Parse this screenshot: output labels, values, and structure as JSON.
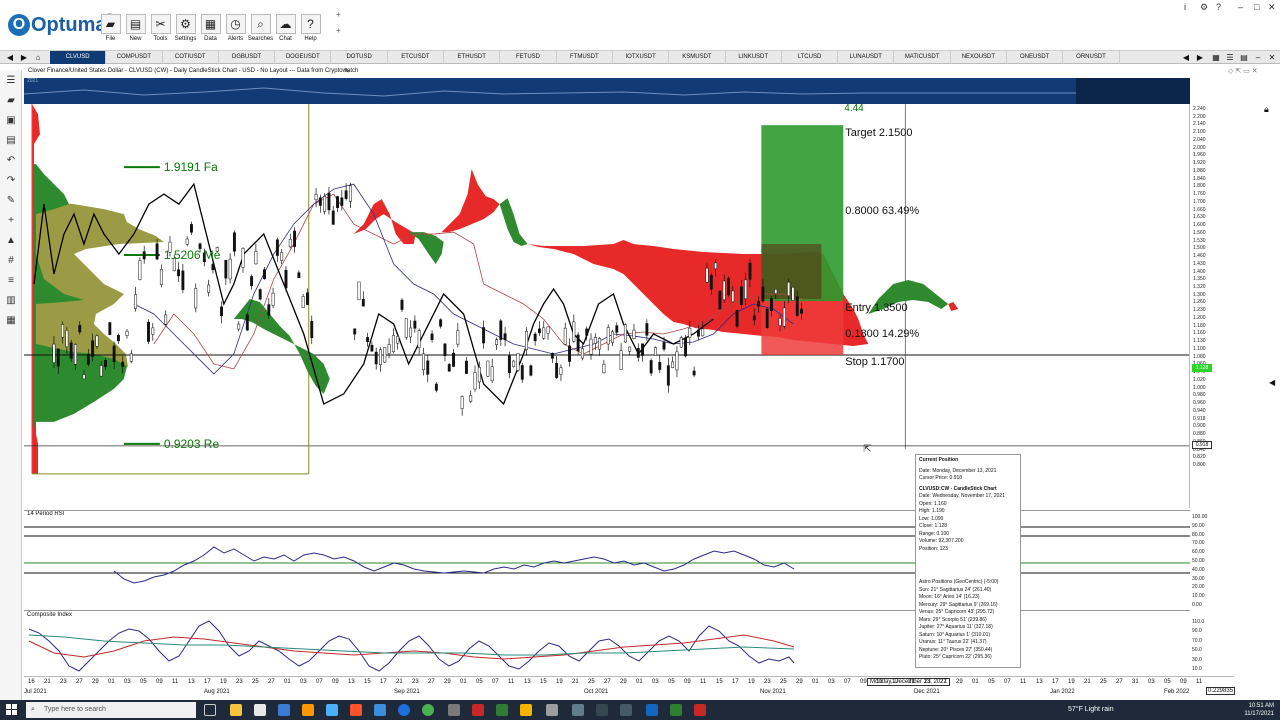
{
  "app": {
    "logo_text": "Optuma",
    "ribbon_buttons": [
      {
        "label": "File",
        "icon": "folder-icon"
      },
      {
        "label": "New",
        "icon": "new-chart-icon"
      },
      {
        "label": "Tools",
        "icon": "tools-icon"
      },
      {
        "label": "Settings",
        "icon": "gear-icon"
      },
      {
        "label": "Data",
        "icon": "data-icon"
      },
      {
        "label": "Alerts",
        "icon": "alarm-clock-icon"
      },
      {
        "label": "Searches",
        "icon": "search-icon"
      },
      {
        "label": "Chat",
        "icon": "chat-icon"
      },
      {
        "label": "Help",
        "icon": "help-icon"
      }
    ]
  },
  "tabs": [
    "CLVUSD",
    "COMPUSDT",
    "COTIUSDT",
    "DGBUSDT",
    "DOGEUSDT",
    "DOTUSD",
    "ETCUSDT",
    "ETHUSDT",
    "FETUSD",
    "FTMUSDT",
    "IOTXUSDT",
    "KSMUSDT",
    "LINKUSDT",
    "LTCUSD",
    "LUNAUSDT",
    "MATICUSDT",
    "NEXOUSDT",
    "ONEUSDT",
    "ORNUSDT"
  ],
  "active_tab": "CLVUSD",
  "chart": {
    "title": "Clover Finance/United States Dollar - CLVUSD (CW) - Daily CandleStick Chart - USD - No Layout --- Data from Cryptowatch",
    "overview_label": "2021",
    "annotations": {
      "fib_top": "1.9191  Fa",
      "fib_mid": "1.5206  Me",
      "fib_low": "0.9203  Re",
      "ratio_top": "4.44",
      "target": "Target  2.1500",
      "gain": "0.8000   63.49%",
      "entry": "Entry  1.3500",
      "loss": "0.1800   14.29%",
      "stop": "Stop   1.1700"
    },
    "price_ticks": [
      "2.240",
      "2.200",
      "2.140",
      "2.100",
      "2.040",
      "2.000",
      "1.960",
      "1.920",
      "1.880",
      "1.840",
      "1.800",
      "1.760",
      "1.700",
      "1.660",
      "1.630",
      "1.600",
      "1.560",
      "1.530",
      "1.500",
      "1.460",
      "1.430",
      "1.400",
      "1.350",
      "1.320",
      "1.300",
      "1.260",
      "1.230",
      "1.200",
      "1.180",
      "1.160",
      "1.130",
      "1.100",
      "1.080",
      "1.060",
      "1.040",
      "1.020",
      "1.000",
      "0.980",
      "0.960",
      "0.940",
      "0.918",
      "0.900",
      "0.880",
      "0.860",
      "0.840",
      "0.820",
      "0.800"
    ],
    "last_price": "1.128",
    "cursor_price": "0.918"
  },
  "rsi": {
    "label": "14 Period RSI",
    "ticks": [
      "100.00",
      "90.00",
      "80.00",
      "70.00",
      "60.00",
      "50.00",
      "40.00",
      "30.00",
      "20.00",
      "10.00",
      "0.00"
    ]
  },
  "composite": {
    "label": "Composite Index",
    "ticks": [
      "110.0",
      "90.0",
      "70.0",
      "50.0",
      "30.0",
      "10.0"
    ]
  },
  "dates": {
    "days": [
      "16",
      "21",
      "23",
      "27",
      "29",
      "01",
      "03",
      "05",
      "09",
      "11",
      "13",
      "17",
      "19",
      "23",
      "25",
      "27",
      "01",
      "03",
      "07",
      "09",
      "13",
      "15",
      "17",
      "21",
      "23",
      "27",
      "29",
      "01",
      "05",
      "07",
      "11",
      "13",
      "15",
      "19",
      "21",
      "25",
      "27",
      "29",
      "01",
      "03",
      "05",
      "09",
      "11",
      "15",
      "17",
      "19",
      "23",
      "25",
      "29",
      "01",
      "03",
      "07",
      "09",
      "13",
      "17",
      "21",
      "23",
      "27",
      "29",
      "01",
      "05",
      "07",
      "11",
      "13",
      "17",
      "19",
      "21",
      "25",
      "27",
      "31",
      "03",
      "05",
      "09",
      "11"
    ],
    "months": [
      "Jul 2021",
      "Aug 2021",
      "Sep 2021",
      "Oct 2021",
      "Nov 2021",
      "Dec 2021",
      "Jan 2022",
      "Feb 2022"
    ],
    "cursor_date": "Monday, December 13, 2021",
    "coord_readout": "0.229835"
  },
  "info_box": {
    "title": "Current Position",
    "date": "Date: Monday, December 13, 2021",
    "cursor_price": "Cursor Price: 0.918",
    "chart_title": "CLVUSD:CW - CandleStick Chart",
    "bar_date": "Date: Wednesday, November 17, 2021",
    "open": "Open: 1.160",
    "high": "High: 1.190",
    "low": "Low: 1.090",
    "close": "Close: 1.128",
    "range": "Range: 0.100",
    "volume": "Volume: 92,307.200",
    "position": "Position: 123",
    "astro_title": "Astro Positions (GeoCentric) (-5:00)",
    "astro": [
      "Sun: 21° Sagittarius 24' (261.40)",
      "Moon: 16° Aries 14' (16.23)",
      "Mercury: 29° Sagittarius 9' (269.16)",
      "Venus: 25° Capricorn 43' (295.72)",
      "Mars: 29° Scorpio 51' (239.86)",
      "Jupiter: 27° Aquarius 11' (327.18)",
      "Saturn: 10° Aquarius 1' (310.01)",
      "Uranus: 11° Taurus 22' (41.37)",
      "Neptune: 20° Pisces 27' (350.44)",
      "Pluto: 25° Capricorn 22' (295.36)"
    ]
  },
  "taskbar": {
    "search_placeholder": "Type here to search",
    "weather": "57°F  Light rain",
    "time": "10:51 AM",
    "date": "11/17/2021"
  },
  "colors": {
    "navy": "#0f3a74",
    "bull_cloud": "#2f8a2f",
    "bear_cloud": "#e8292a",
    "target_zone": "#2e9a2e",
    "stop_zone": "#ef3b3b",
    "volume_profile": "#8a8a24"
  }
}
